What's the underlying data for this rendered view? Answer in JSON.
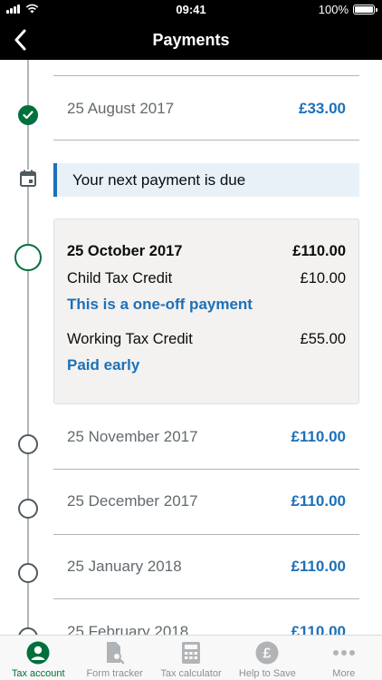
{
  "status_bar": {
    "time": "09:41",
    "battery": "100%"
  },
  "nav": {
    "title": "Payments"
  },
  "payments": [
    {
      "date": "25 August 2017",
      "amount": "£33.00",
      "status": "paid"
    },
    {
      "date": "25 November 2017",
      "amount": "£110.00"
    },
    {
      "date": "25 December 2017",
      "amount": "£110.00"
    },
    {
      "date": "25 January 2018",
      "amount": "£110.00"
    },
    {
      "date": "25 February 2018",
      "amount": "£110.00"
    }
  ],
  "notice": {
    "text": "Your next payment is due"
  },
  "next_payment": {
    "date": "25 October 2017",
    "total": "£110.00",
    "items": [
      {
        "label": "Child Tax Credit",
        "amount": "£10.00",
        "note": "This is a one-off payment"
      },
      {
        "label": "Working Tax Credit",
        "amount": "£55.00",
        "note": "Paid early"
      }
    ]
  },
  "tabs": [
    {
      "label": "Tax account",
      "icon": "person-icon",
      "active": true
    },
    {
      "label": "Form tracker",
      "icon": "document-search-icon"
    },
    {
      "label": "Tax calculator",
      "icon": "calculator-icon"
    },
    {
      "label": "Help to Save",
      "icon": "pound-coin-icon"
    },
    {
      "label": "More",
      "icon": "more-dots-icon"
    }
  ],
  "colors": {
    "accent_blue": "#1d70b8",
    "success_green": "#00703c",
    "header": "#000000"
  }
}
